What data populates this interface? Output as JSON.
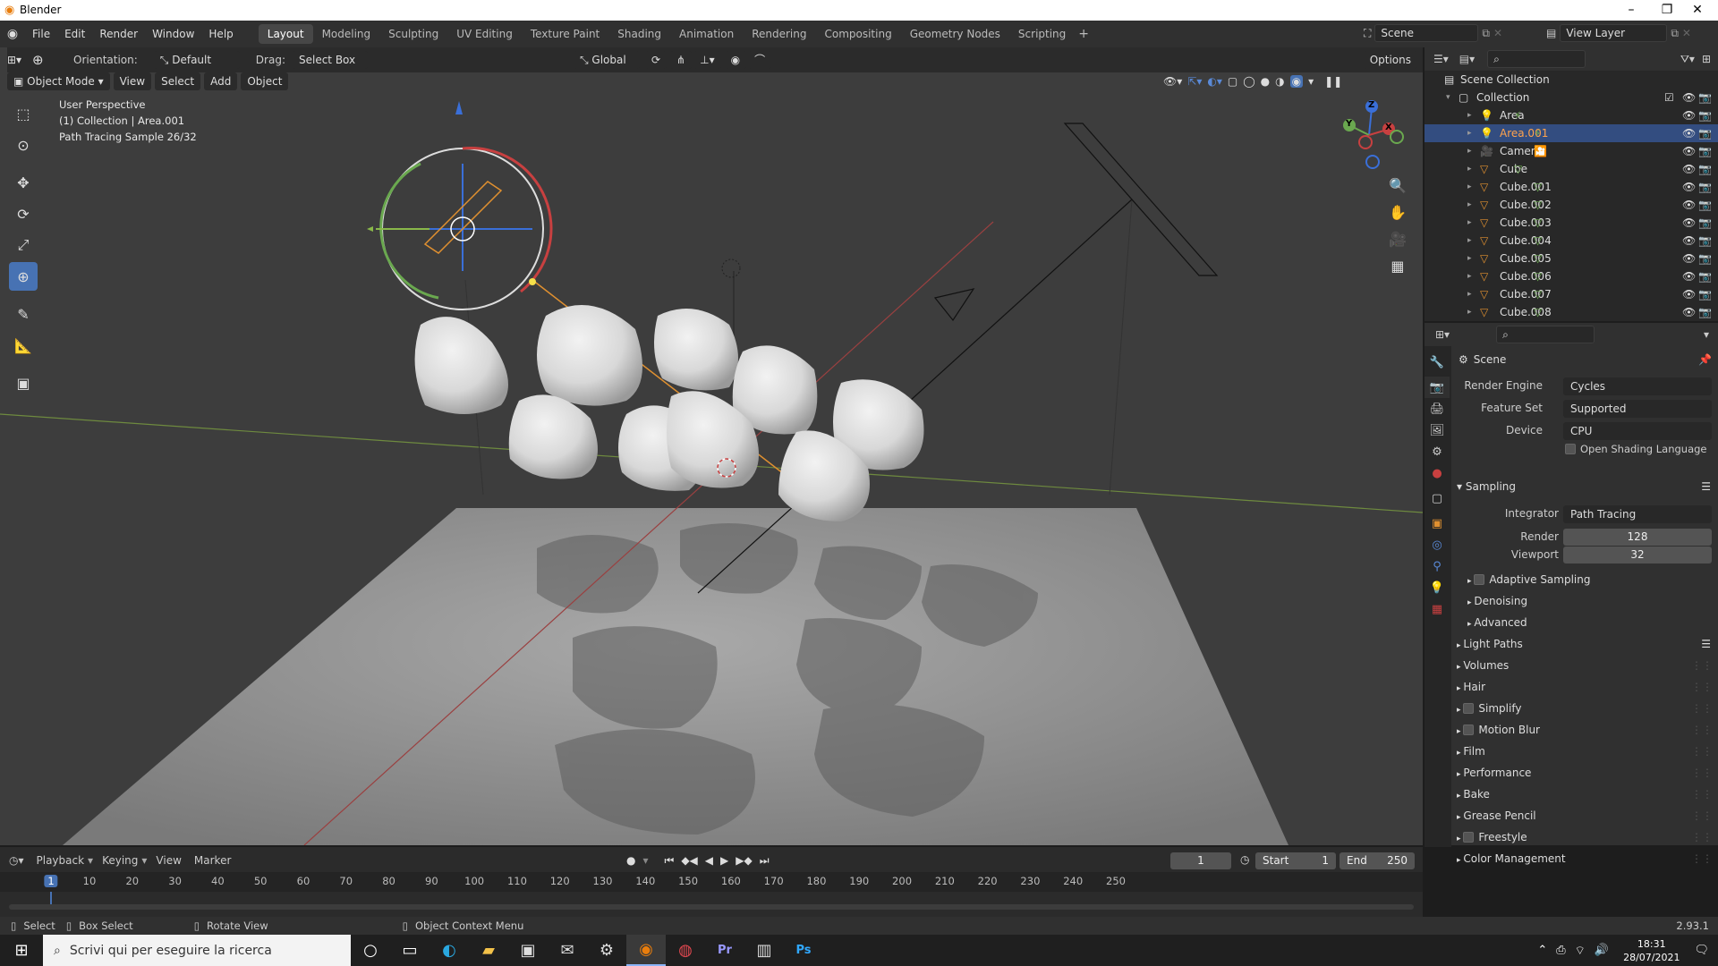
{
  "window": {
    "title": "Blender",
    "minimize": "–",
    "maximize": "❐",
    "close": "✕"
  },
  "menus": [
    "File",
    "Edit",
    "Render",
    "Window",
    "Help"
  ],
  "workspaces": [
    {
      "label": "Layout",
      "active": true
    },
    {
      "label": "Modeling"
    },
    {
      "label": "Sculpting"
    },
    {
      "label": "UV Editing"
    },
    {
      "label": "Texture Paint"
    },
    {
      "label": "Shading"
    },
    {
      "label": "Animation"
    },
    {
      "label": "Rendering"
    },
    {
      "label": "Compositing"
    },
    {
      "label": "Geometry Nodes"
    },
    {
      "label": "Scripting"
    }
  ],
  "add_workspace": "+",
  "scene": {
    "name": "Scene",
    "view_layer": "View Layer"
  },
  "toolheader": {
    "orientation_label": "Orientation:",
    "orientation_value": "Default",
    "drag_label": "Drag:",
    "drag_value": "Select Box",
    "transform": "Global",
    "options": "Options"
  },
  "viewport_header": {
    "mode": "Object Mode",
    "menus": [
      "View",
      "Select",
      "Add",
      "Object"
    ]
  },
  "overlay_text": {
    "line1": "User Perspective",
    "line2": "(1) Collection | Area.001",
    "line3": "Path Tracing Sample 26/32"
  },
  "gizmo": {
    "z": "Z",
    "y": "Y",
    "x": "X"
  },
  "outliner": {
    "root": "Scene Collection",
    "collection": "Collection",
    "items": [
      {
        "name": "Area",
        "type": "light"
      },
      {
        "name": "Area.001",
        "type": "light",
        "selected": true
      },
      {
        "name": "Camera",
        "type": "camera"
      },
      {
        "name": "Cube",
        "type": "mesh"
      },
      {
        "name": "Cube.001",
        "type": "mesh"
      },
      {
        "name": "Cube.002",
        "type": "mesh"
      },
      {
        "name": "Cube.003",
        "type": "mesh"
      },
      {
        "name": "Cube.004",
        "type": "mesh"
      },
      {
        "name": "Cube.005",
        "type": "mesh"
      },
      {
        "name": "Cube.006",
        "type": "mesh"
      },
      {
        "name": "Cube.007",
        "type": "mesh"
      },
      {
        "name": "Cube.008",
        "type": "mesh"
      }
    ]
  },
  "properties": {
    "context": "Scene",
    "render_engine_label": "Render Engine",
    "render_engine": "Cycles",
    "feature_set_label": "Feature Set",
    "feature_set": "Supported",
    "device_label": "Device",
    "device": "CPU",
    "osl_label": "Open Shading Language",
    "sampling": "Sampling",
    "integrator_label": "Integrator",
    "integrator": "Path Tracing",
    "render_label": "Render",
    "render_samples": "128",
    "viewport_label": "Viewport",
    "viewport_samples": "32",
    "subpanels": [
      "Adaptive Sampling",
      "Denoising",
      "Advanced"
    ],
    "panels": [
      {
        "label": "Light Paths",
        "checkbox": false
      },
      {
        "label": "Volumes",
        "checkbox": false
      },
      {
        "label": "Hair",
        "checkbox": false
      },
      {
        "label": "Simplify",
        "checkbox": true
      },
      {
        "label": "Motion Blur",
        "checkbox": true
      },
      {
        "label": "Film",
        "checkbox": false
      },
      {
        "label": "Performance",
        "checkbox": false
      },
      {
        "label": "Bake",
        "checkbox": false
      },
      {
        "label": "Grease Pencil",
        "checkbox": false
      },
      {
        "label": "Freestyle",
        "checkbox": true
      },
      {
        "label": "Color Management",
        "checkbox": false
      }
    ]
  },
  "timeline": {
    "menus": [
      "Playback",
      "Keying",
      "View",
      "Marker"
    ],
    "current_frame": "1",
    "start_label": "Start",
    "start": "1",
    "end_label": "End",
    "end": "250",
    "ruler": [
      "1",
      "10",
      "20",
      "30",
      "40",
      "50",
      "60",
      "70",
      "80",
      "90",
      "100",
      "110",
      "120",
      "130",
      "140",
      "150",
      "160",
      "170",
      "180",
      "190",
      "200",
      "210",
      "220",
      "230",
      "240",
      "250"
    ]
  },
  "status": {
    "select": "Select",
    "box_select": "Box Select",
    "rotate": "Rotate View",
    "context": "Object Context Menu",
    "version": "2.93.1"
  },
  "taskbar": {
    "search_placeholder": "Scrivi qui per eseguire la ricerca",
    "time": "18:31",
    "date": "28/07/2021"
  },
  "colors": {
    "accent": "#4772b3",
    "selected_row": "#334d80",
    "viewport_bg": "#3d3d3d",
    "panel_bg": "#303030"
  }
}
